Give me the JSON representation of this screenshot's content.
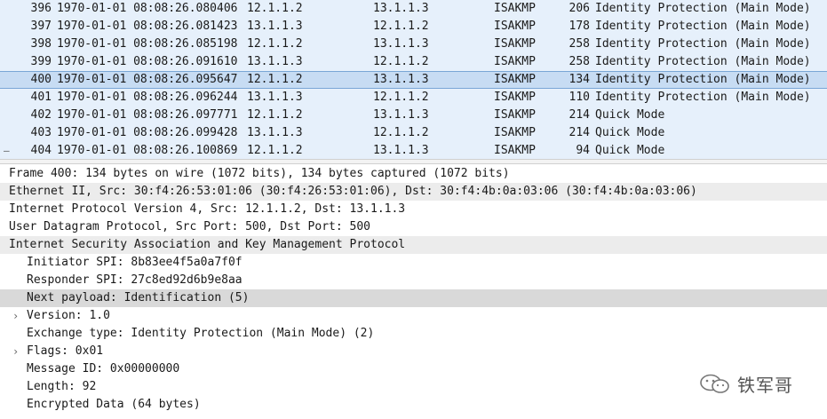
{
  "packet_list": {
    "rows": [
      {
        "marker": "",
        "no": "396",
        "time": "1970-01-01 08:08:26.080406",
        "src": "12.1.1.2",
        "dst": "13.1.1.3",
        "proto": "ISAKMP",
        "len": "206",
        "info": "Identity Protection (Main Mode)"
      },
      {
        "marker": "",
        "no": "397",
        "time": "1970-01-01 08:08:26.081423",
        "src": "13.1.1.3",
        "dst": "12.1.1.2",
        "proto": "ISAKMP",
        "len": "178",
        "info": "Identity Protection (Main Mode)"
      },
      {
        "marker": "",
        "no": "398",
        "time": "1970-01-01 08:08:26.085198",
        "src": "12.1.1.2",
        "dst": "13.1.1.3",
        "proto": "ISAKMP",
        "len": "258",
        "info": "Identity Protection (Main Mode)"
      },
      {
        "marker": "",
        "no": "399",
        "time": "1970-01-01 08:08:26.091610",
        "src": "13.1.1.3",
        "dst": "12.1.1.2",
        "proto": "ISAKMP",
        "len": "258",
        "info": "Identity Protection (Main Mode)"
      },
      {
        "marker": "",
        "no": "400",
        "time": "1970-01-01 08:08:26.095647",
        "src": "12.1.1.2",
        "dst": "13.1.1.3",
        "proto": "ISAKMP",
        "len": "134",
        "info": "Identity Protection (Main Mode)"
      },
      {
        "marker": "",
        "no": "401",
        "time": "1970-01-01 08:08:26.096244",
        "src": "13.1.1.3",
        "dst": "12.1.1.2",
        "proto": "ISAKMP",
        "len": "110",
        "info": "Identity Protection (Main Mode)"
      },
      {
        "marker": "",
        "no": "402",
        "time": "1970-01-01 08:08:26.097771",
        "src": "12.1.1.2",
        "dst": "13.1.1.3",
        "proto": "ISAKMP",
        "len": "214",
        "info": "Quick Mode"
      },
      {
        "marker": "",
        "no": "403",
        "time": "1970-01-01 08:08:26.099428",
        "src": "13.1.1.3",
        "dst": "12.1.1.2",
        "proto": "ISAKMP",
        "len": "214",
        "info": "Quick Mode"
      },
      {
        "marker": "–",
        "no": "404",
        "time": "1970-01-01 08:08:26.100869",
        "src": "12.1.1.2",
        "dst": "13.1.1.3",
        "proto": "ISAKMP",
        "len": "94",
        "info": "Quick Mode"
      }
    ],
    "selected_index": 4
  },
  "details": {
    "rows": [
      {
        "caret": "",
        "indent": 0,
        "text": "Frame 400: 134 bytes on wire (1072 bits), 134 bytes captured (1072 bits)",
        "style": ""
      },
      {
        "caret": "",
        "indent": 0,
        "text": "Ethernet II, Src: 30:f4:26:53:01:06 (30:f4:26:53:01:06), Dst: 30:f4:4b:0a:03:06 (30:f4:4b:0a:03:06)",
        "style": "shade"
      },
      {
        "caret": "",
        "indent": 0,
        "text": "Internet Protocol Version 4, Src: 12.1.1.2, Dst: 13.1.1.3",
        "style": ""
      },
      {
        "caret": "",
        "indent": 0,
        "text": "User Datagram Protocol, Src Port: 500, Dst Port: 500",
        "style": ""
      },
      {
        "caret": "",
        "indent": 0,
        "text": "Internet Security Association and Key Management Protocol",
        "style": "shade"
      },
      {
        "caret": "",
        "indent": 1,
        "text": "Initiator SPI: 8b83ee4f5a0a7f0f",
        "style": ""
      },
      {
        "caret": "",
        "indent": 1,
        "text": "Responder SPI: 27c8ed92d6b9e8aa",
        "style": ""
      },
      {
        "caret": "",
        "indent": 1,
        "text": "Next payload: Identification (5)",
        "style": "hl"
      },
      {
        "caret": "›",
        "indent": 1,
        "text": "Version: 1.0",
        "style": ""
      },
      {
        "caret": "",
        "indent": 1,
        "text": "Exchange type: Identity Protection (Main Mode) (2)",
        "style": ""
      },
      {
        "caret": "›",
        "indent": 1,
        "text": "Flags: 0x01",
        "style": ""
      },
      {
        "caret": "",
        "indent": 1,
        "text": "Message ID: 0x00000000",
        "style": ""
      },
      {
        "caret": "",
        "indent": 1,
        "text": "Length: 92",
        "style": ""
      },
      {
        "caret": "",
        "indent": 1,
        "text": "Encrypted Data (64 bytes)",
        "style": ""
      }
    ]
  },
  "watermark": {
    "text": "铁军哥",
    "icon": "wechat-icon",
    "color": "#555555"
  }
}
